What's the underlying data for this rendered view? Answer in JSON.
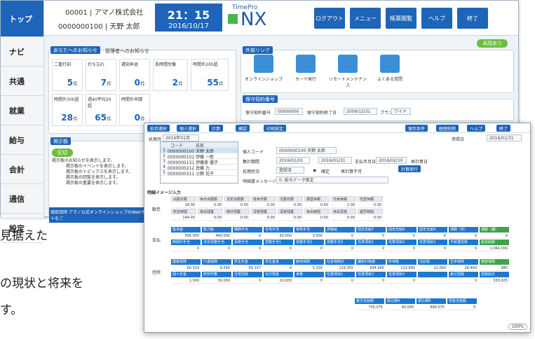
{
  "colors": {
    "accent": "#1e64b8",
    "green": "#6abf3c",
    "side_active": "#1e64b8"
  },
  "sidebar": {
    "items": [
      {
        "label": "トップ"
      },
      {
        "label": "ナビ"
      },
      {
        "label": "共通"
      },
      {
        "label": "就業"
      },
      {
        "label": "給与"
      },
      {
        "label": "会計"
      },
      {
        "label": "通信"
      },
      {
        "label": "設定"
      }
    ]
  },
  "header": {
    "company": "00001 | アマノ株式会社",
    "user": "0000000100 | 天野 太郎",
    "time": "21：15",
    "date": "2016/10/17",
    "logo_small": "TimePro",
    "logo_big": "NX",
    "buttons": [
      "ログアウト",
      "メニュー",
      "帳票閲覧",
      "ヘルプ",
      "終了"
    ]
  },
  "notice": {
    "tab1": "あなたへのお知らせ",
    "tab2": "管理者へのお知らせ",
    "cells": [
      {
        "label": "二重打刻",
        "value": "5",
        "unit": "件"
      },
      {
        "label": "打ち忘れ",
        "value": "7",
        "unit": "件"
      },
      {
        "label": "遅刻早退",
        "value": "0",
        "unit": "件"
      },
      {
        "label": "長時間労働",
        "value": "2",
        "unit": "件"
      },
      {
        "label": "時間外20h超",
        "value": "55",
        "unit": "件"
      },
      {
        "label": "時間外30h超",
        "value": "28",
        "unit": "件"
      },
      {
        "label": "週40平均20超",
        "value": "65",
        "unit": "件"
      },
      {
        "label": "時間外申請",
        "value": "0",
        "unit": "件"
      }
    ]
  },
  "links": {
    "title": "外部リンク",
    "badge": "未読あり",
    "items": [
      "オンラインショップ",
      "カード発行",
      "リモートメンテナンス",
      "よくある質問"
    ]
  },
  "maint": {
    "title": "保守契約番号",
    "label1": "保守契約番号",
    "val1": "00000000",
    "label2": "保守契約終了日",
    "val2": "2009/12/31",
    "label3": "プラン",
    "val3": "ワイド"
  },
  "board": {
    "title": "掲示板",
    "green": "区切",
    "lines": [
      "掲示板のお知らせを表示します。",
      "掲示板のイベントを表示します。",
      "掲示板のトピックスを表示します。",
      "掲示板の回覧を表示します。",
      "掲示板の重要を表示します。"
    ],
    "footer": "項目説明  アマノ公式オンラインショップのWebサイトをご"
  },
  "bg_text": [
    "見据えた",
    "の現状と将来を",
    "す。"
  ],
  "win2": {
    "toolbar": [
      "前月選択",
      "個人選択",
      "計算",
      "確認",
      "印刷設定"
    ],
    "toolbar_right": [
      "保存条件",
      "経歴削除",
      "ヘルプ",
      "終了"
    ],
    "period_label": "処理月",
    "period": "2016年01月",
    "ref_label": "参照日",
    "ref": "2016/01/31",
    "grid_head": [
      "コード",
      "氏名"
    ],
    "grid_rows": [
      [
        "1",
        "0000000100 天野 太郎"
      ],
      [
        "2",
        "0000000101 伊藤 一郎"
      ],
      [
        "3",
        "0000000131 伊藤原 優子"
      ],
      [
        "4",
        "0000000212 佐藤 力"
      ],
      [
        "5",
        "0000000311 小野 花子"
      ]
    ],
    "f_code": "個人コード",
    "f_code_v": "0000000100 天野 太郎",
    "f_period": "集計期間",
    "f_from": "2016/01/01",
    "f_to": "2016/01/31",
    "f_pay": "支払年月日",
    "f_payv": "2016/02/10",
    "f_fix": "再計算日",
    "f_status": "処理状況",
    "f_statusv": "登録済",
    "f_check1": "確定",
    "f_check2": "再計算不可",
    "f_btn": "計算実行",
    "f_msg": "明細書メッセージ",
    "f_msgv": "0. 給与データ推定",
    "section_title": "明細イメージ入力",
    "kintai": {
      "label": "勤怠",
      "h1": [
        "出勤日数",
        "休日出勤数",
        "法定出勤数",
        "有休日数",
        "欠勤日数",
        "振替休暇",
        "代休休暇",
        "代替休暇"
      ],
      "v1": [
        "18.00",
        "0.00",
        "0.00",
        "0.00",
        "0.00",
        "0.00",
        "1.00",
        "0.00"
      ],
      "h2": [
        "所定時間",
        "単出残業",
        "時外残業",
        "深夜残業",
        "深夜残業",
        "休出時間",
        "休出深夜",
        "遅早時間"
      ],
      "v2": [
        "144:00",
        "0:00",
        "0:00",
        "0:00",
        "0:00",
        "0:00",
        "0:00",
        "0:00"
      ]
    },
    "shikyu": {
      "label": "支払",
      "h1": [
        "基本給",
        "能力給",
        "職務手当",
        "住宅手当",
        "家族手当",
        "調整給",
        "固定支給7",
        "固定支給8",
        "固定支給9",
        "通勤（非）",
        "通勤（課）"
      ],
      "v1": [
        "566,000",
        "440,000",
        "0",
        "50,000",
        "3,000",
        "0",
        "0",
        "0",
        "0",
        "0",
        "0"
      ],
      "h2": [
        "時間外手当",
        "法定残業手当",
        "深夜手当",
        "変動手当1",
        "変動手当2",
        "変動手当3",
        "任意項目1",
        "任意項目2",
        "任意項目3",
        "不就業控除",
        "総支給額"
      ],
      "v2": [
        "0",
        "0",
        "0",
        "0",
        "0",
        "0",
        "0",
        "0",
        "0",
        "0",
        "1,064,000"
      ]
    },
    "kojo": {
      "label": "控除",
      "h1": [
        "健康保険",
        "介護保険",
        "厚生年金",
        "厚生基金",
        "雇用保険",
        "社会保険計",
        "課税対象額",
        "所得税",
        "住民税",
        "生命保険",
        "損害保険"
      ],
      "v1": [
        "60,319",
        "9,556",
        "54,157",
        "0",
        "5,320",
        "129,355",
        "934,645",
        "113,690",
        "12,000",
        "26,400",
        "980"
      ],
      "h2": [
        "個人年金",
        "財形貯蓄",
        "住宅控除",
        "社内預金",
        "食費",
        "任意項目1",
        "任意項目2",
        "任意項目3",
        "",
        "差引控除",
        "控除総計"
      ],
      "v2": [
        "1,500",
        "30,000",
        "0",
        "20,000",
        "0",
        "0",
        "0",
        "0",
        "",
        "0",
        "333,925"
      ]
    },
    "totals": {
      "h": [
        "差引支給額",
        "振込額A",
        "振込額B",
        "現金支給額"
      ],
      "v": [
        "730,075",
        "40,000",
        "690,075",
        "0"
      ]
    },
    "zoom": "100%"
  }
}
